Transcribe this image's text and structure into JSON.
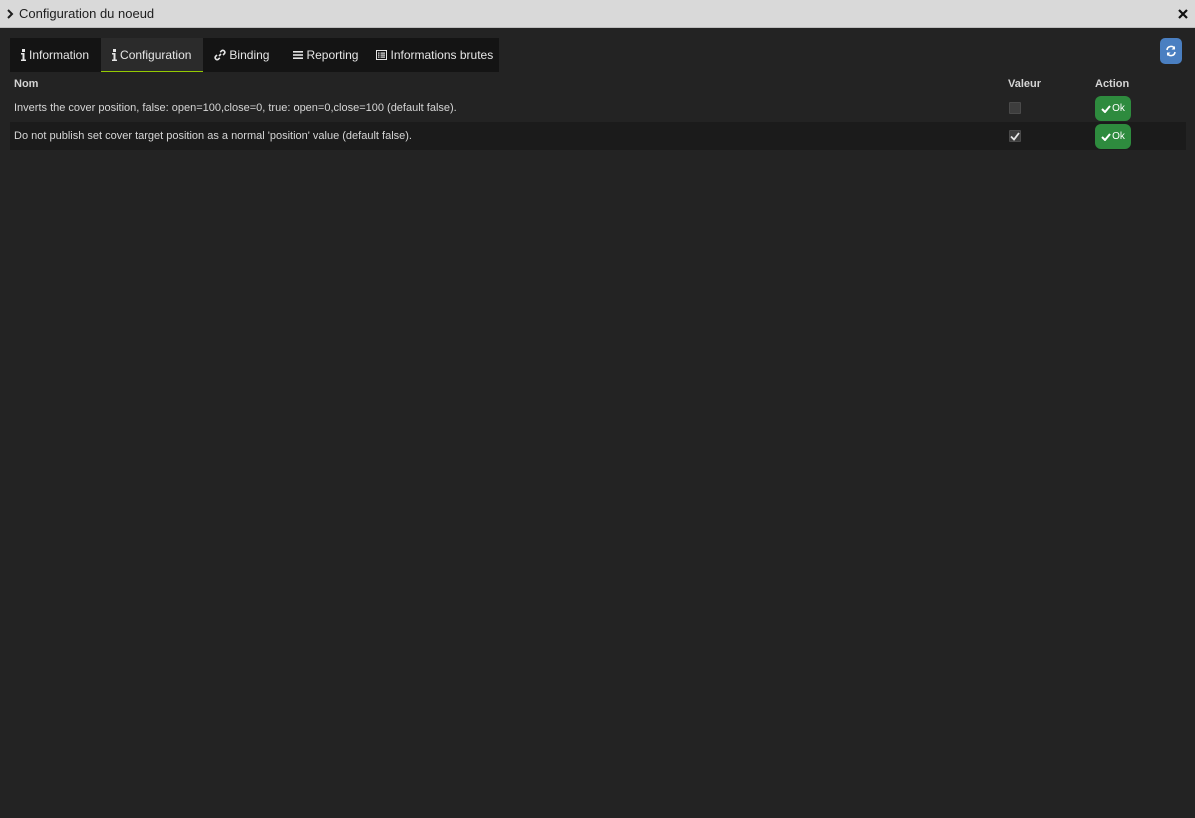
{
  "window": {
    "title": "Configuration du noeud",
    "chevron_icon": "chevron-right-icon",
    "close_icon": "close-icon"
  },
  "tabs": [
    {
      "label": "Information",
      "icon": "info-icon",
      "active": false
    },
    {
      "label": "Configuration",
      "icon": "info-icon",
      "active": true
    },
    {
      "label": "Binding",
      "icon": "link-icon",
      "active": false
    },
    {
      "label": "Reporting",
      "icon": "bars-icon",
      "active": false
    },
    {
      "label": "Informations brutes",
      "icon": "list-alt-icon",
      "active": false
    }
  ],
  "refresh_icon": "refresh-icon",
  "table": {
    "headers": {
      "name": "Nom",
      "value": "Valeur",
      "action": "Action"
    },
    "rows": [
      {
        "name": "Inverts the cover position, false: open=100,close=0, true: open=0,close=100 (default false).",
        "checked": false,
        "action": "Ok"
      },
      {
        "name": "Do not publish set cover target position as a normal 'position' value (default false).",
        "checked": true,
        "action": "Ok"
      }
    ]
  },
  "colors": {
    "accent_green": "#94ca02",
    "ok_button": "#2e8b3e",
    "refresh_button": "#4a7fc1",
    "background": "#232323"
  }
}
